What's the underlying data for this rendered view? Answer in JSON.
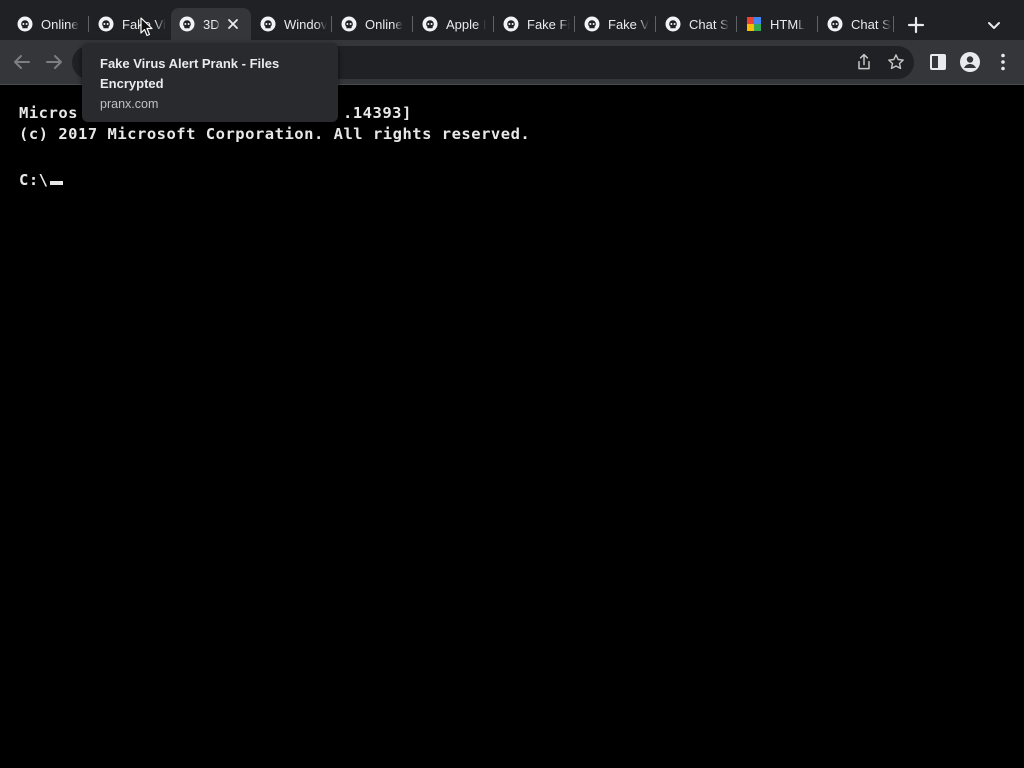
{
  "tabs": [
    {
      "title": "Online",
      "icon": "pranx-skull-icon",
      "active": false
    },
    {
      "title": "Fake Vi",
      "icon": "pranx-skull-icon",
      "active": false
    },
    {
      "title": "3D",
      "icon": "pranx-skull-icon",
      "active": true
    },
    {
      "title": "Windov",
      "icon": "pranx-skull-icon",
      "active": false
    },
    {
      "title": "Online",
      "icon": "pranx-skull-icon",
      "active": false
    },
    {
      "title": "Apple I",
      "icon": "pranx-skull-icon",
      "active": false
    },
    {
      "title": "Fake Fi",
      "icon": "pranx-skull-icon",
      "active": false
    },
    {
      "title": "Fake V",
      "icon": "pranx-skull-icon",
      "active": false
    },
    {
      "title": "Chat S",
      "icon": "pranx-skull-icon",
      "active": false
    },
    {
      "title": "HTML",
      "icon": "html-colored-icon",
      "active": false
    },
    {
      "title": "Chat S",
      "icon": "pranx-skull-icon",
      "active": false
    }
  ],
  "tooltip": {
    "title": "Fake Virus Alert Prank - Files Encrypted",
    "url": "pranx.com"
  },
  "terminal": {
    "line1_left": "Micros",
    "line1_right": ".14393]",
    "line2": "(c) 2017 Microsoft Corporation. All rights reserved.",
    "prompt": "C:\\"
  },
  "colors": {
    "tabstrip_bg": "#202124",
    "toolbar_bg": "#35363a",
    "terminal_bg": "#000000",
    "terminal_fg": "#e8e8e8"
  }
}
